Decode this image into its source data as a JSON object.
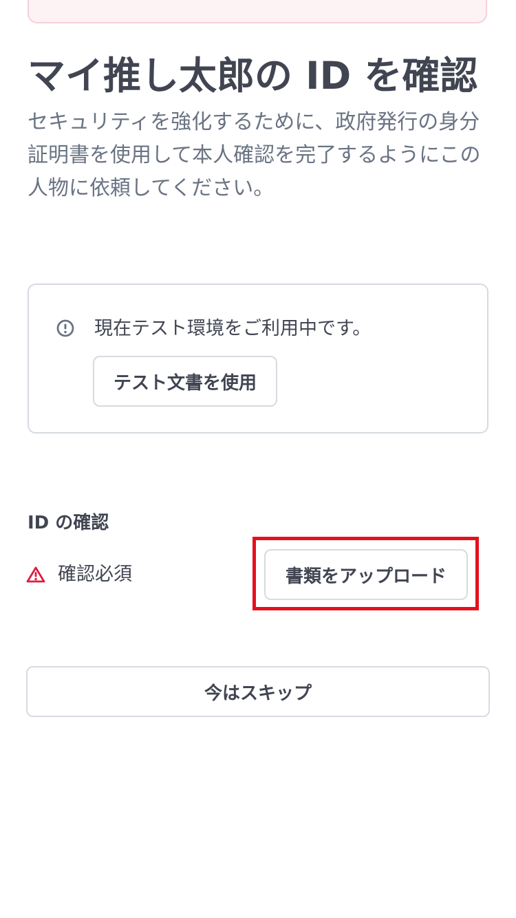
{
  "header": {
    "title": "マイ推し太郎の ID を確認",
    "description": "セキュリティを強化するために、政府発行の身分証明書を使用して本人確認を完了するようにこの人物に依頼してください。"
  },
  "test_mode": {
    "icon": "info-circle-icon",
    "notice": "現在テスト環境をご利用中です。",
    "button_label": "テスト文書を使用"
  },
  "verification": {
    "heading": "ID の確認",
    "status_icon": "warning-triangle-icon",
    "status_color": "#df1b41",
    "status_text": "確認必須",
    "upload_label": "書類をアップロード",
    "highlight_color": "#e5101d"
  },
  "footer": {
    "skip_label": "今はスキップ"
  },
  "colors": {
    "text_primary": "#414552",
    "text_secondary": "#6a7383",
    "border": "#d5dbe1",
    "banner_background": "#fdf3f5",
    "banner_border": "#f5d0da"
  }
}
